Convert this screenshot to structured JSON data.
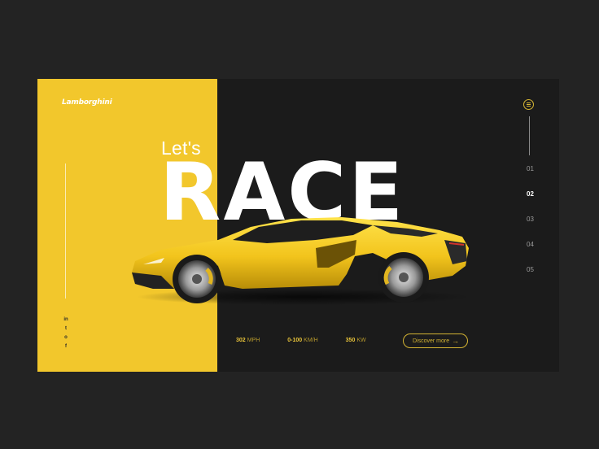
{
  "brand": {
    "logo_text": "Lamborghini"
  },
  "hero": {
    "kicker": "Let's",
    "title": "RACE"
  },
  "social": {
    "icons": [
      "linkedin-icon",
      "twitter-icon",
      "instagram-icon",
      "facebook-icon"
    ],
    "glyphs": [
      "in",
      "t",
      "o",
      "f"
    ]
  },
  "stats": [
    {
      "value": "302",
      "unit": "MPH"
    },
    {
      "value": "0-100",
      "unit": "KM/H"
    },
    {
      "value": "350",
      "unit": "KW"
    }
  ],
  "cta": {
    "label": "Discover more",
    "arrow": "→"
  },
  "pager": {
    "items": [
      "01",
      "02",
      "03",
      "04",
      "05"
    ],
    "active_index": 1
  },
  "colors": {
    "accent": "#f2c72c",
    "background": "#1b1b1b",
    "outer": "#232323"
  }
}
